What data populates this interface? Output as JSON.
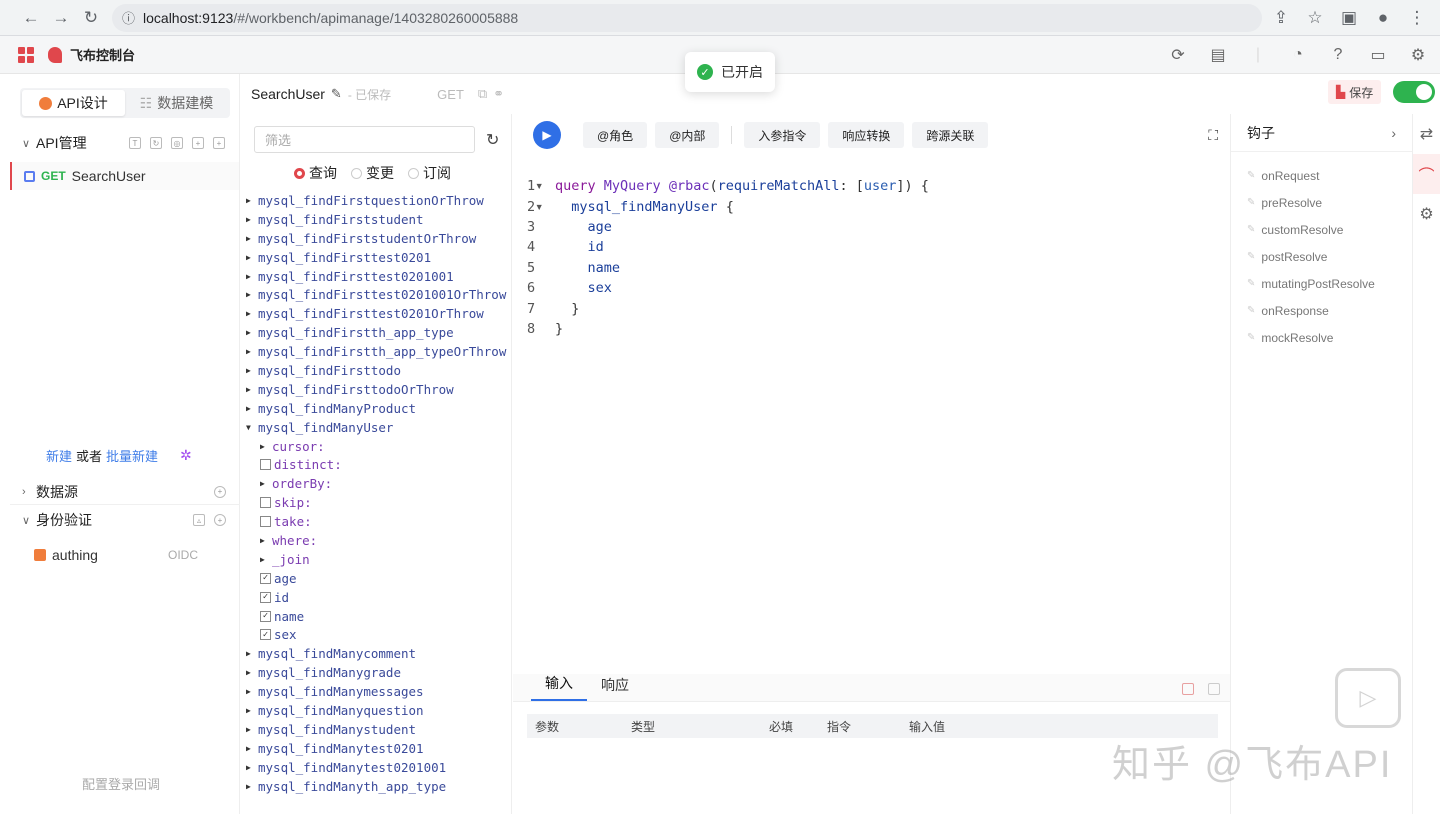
{
  "browser": {
    "url_host": "localhost:9123",
    "url_path": "/#/workbench/apimanage/1403280260005888"
  },
  "app": {
    "name": "飞布控制台"
  },
  "toast": {
    "message": "已开启"
  },
  "header": {
    "api_name": "SearchUser",
    "saved_status": "- 已保存",
    "method": "GET",
    "save_label": "保存"
  },
  "left": {
    "tabs": [
      {
        "label": "API设计"
      },
      {
        "label": "数据建模"
      }
    ],
    "api_section": "API管理",
    "api_item": {
      "method": "GET",
      "name": "SearchUser"
    },
    "new_label": "新建",
    "or_label": "或者",
    "batch_new_label": "批量新建",
    "datasource_section": "数据源",
    "auth_section": "身份验证",
    "auth_item": {
      "name": "authing",
      "type": "OIDC"
    },
    "config_login_label": "配置登录回调"
  },
  "middle": {
    "filter_placeholder": "筛选",
    "radios": [
      {
        "label": "查询"
      },
      {
        "label": "变更"
      },
      {
        "label": "订阅"
      }
    ],
    "tree": [
      {
        "label": "mysql_findFirstquestionOrThrow",
        "kind": "node"
      },
      {
        "label": "mysql_findFirststudent",
        "kind": "node"
      },
      {
        "label": "mysql_findFirststudentOrThrow",
        "kind": "node"
      },
      {
        "label": "mysql_findFirsttest0201",
        "kind": "node"
      },
      {
        "label": "mysql_findFirsttest0201001",
        "kind": "node"
      },
      {
        "label": "mysql_findFirsttest0201001OrThrow",
        "kind": "node"
      },
      {
        "label": "mysql_findFirsttest0201OrThrow",
        "kind": "node"
      },
      {
        "label": "mysql_findFirstth_app_type",
        "kind": "node"
      },
      {
        "label": "mysql_findFirstth_app_typeOrThrow",
        "kind": "node"
      },
      {
        "label": "mysql_findFirsttodo",
        "kind": "node"
      },
      {
        "label": "mysql_findFirsttodoOrThrow",
        "kind": "node"
      },
      {
        "label": "mysql_findManyProduct",
        "kind": "node"
      },
      {
        "label": "mysql_findManyUser",
        "kind": "open"
      },
      {
        "label": "cursor:",
        "kind": "arg"
      },
      {
        "label": "distinct:",
        "kind": "argcb"
      },
      {
        "label": "orderBy:",
        "kind": "arg"
      },
      {
        "label": "skip:",
        "kind": "argcb"
      },
      {
        "label": "take:",
        "kind": "argcb"
      },
      {
        "label": "where:",
        "kind": "arg"
      },
      {
        "label": "_join",
        "kind": "arg"
      },
      {
        "label": "age",
        "kind": "field"
      },
      {
        "label": "id",
        "kind": "field"
      },
      {
        "label": "name",
        "kind": "field"
      },
      {
        "label": "sex",
        "kind": "field"
      },
      {
        "label": "mysql_findManycomment",
        "kind": "node"
      },
      {
        "label": "mysql_findManygrade",
        "kind": "node"
      },
      {
        "label": "mysql_findManymessages",
        "kind": "node"
      },
      {
        "label": "mysql_findManyquestion",
        "kind": "node"
      },
      {
        "label": "mysql_findManystudent",
        "kind": "node"
      },
      {
        "label": "mysql_findManytest0201",
        "kind": "node"
      },
      {
        "label": "mysql_findManytest0201001",
        "kind": "node"
      },
      {
        "label": "mysql_findManyth_app_type",
        "kind": "node"
      }
    ]
  },
  "editor": {
    "toolbar": [
      "@角色",
      "@内部",
      "入参指令",
      "响应转换",
      "跨源关联"
    ],
    "lines": [
      "query MyQuery @rbac(requireMatchAll: [user]) {",
      "  mysql_findManyUser {",
      "    age",
      "    id",
      "    name",
      "    sex",
      "  }",
      "}"
    ]
  },
  "bottom": {
    "tabs": [
      "输入",
      "响应"
    ],
    "columns": [
      "参数",
      "类型",
      "必填",
      "指令",
      "输入值"
    ]
  },
  "hooks": {
    "title": "钩子",
    "items": [
      "onRequest",
      "preResolve",
      "customResolve",
      "postResolve",
      "mutatingPostResolve",
      "onResponse",
      "mockResolve"
    ]
  },
  "watermark": "知乎 @飞布API"
}
